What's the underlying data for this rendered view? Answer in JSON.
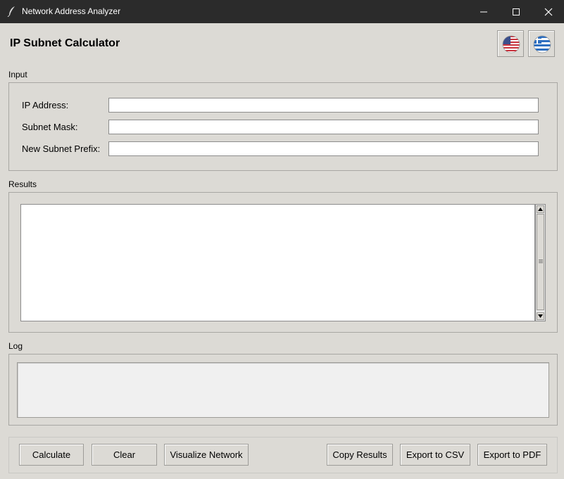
{
  "window": {
    "title": "Network Address Analyzer",
    "controls": [
      "minimize-icon",
      "maximize-icon",
      "close-icon"
    ]
  },
  "header": {
    "title": "IP Subnet Calculator",
    "language_buttons": [
      {
        "icon": "us-flag-icon"
      },
      {
        "icon": "greek-flag-icon"
      }
    ]
  },
  "input_section": {
    "label": "Input",
    "fields": [
      {
        "label": "IP Address:",
        "value": "",
        "placeholder": ""
      },
      {
        "label": "Subnet Mask:",
        "value": "",
        "placeholder": ""
      },
      {
        "label": "New Subnet Prefix:",
        "value": "",
        "placeholder": ""
      }
    ]
  },
  "results_section": {
    "label": "Results",
    "text": ""
  },
  "log_section": {
    "label": "Log",
    "text": ""
  },
  "buttons": {
    "calculate": "Calculate",
    "clear": "Clear",
    "visualize": "Visualize Network",
    "copy": "Copy Results",
    "export_csv": "Export to CSV",
    "export_pdf": "Export to PDF"
  },
  "colors": {
    "titlebar": "#2b2b2b",
    "background": "#dcdad5",
    "field_background": "#ffffff"
  }
}
